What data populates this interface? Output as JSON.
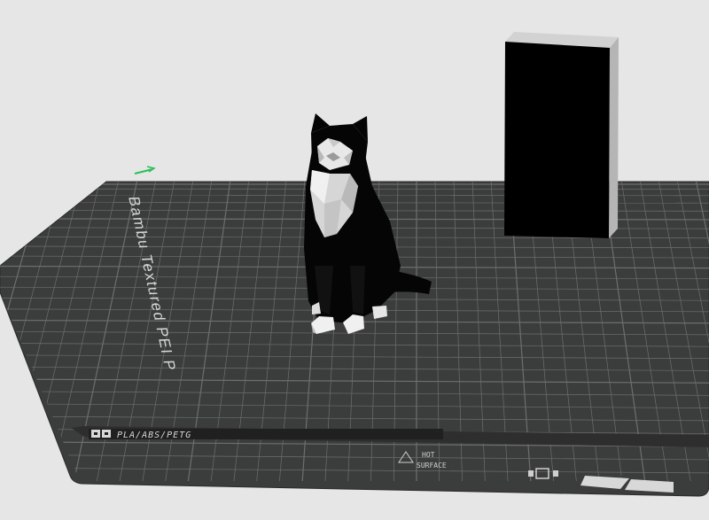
{
  "viewport": {
    "background": "#e6e6e6",
    "plate": {
      "name": "Bambu Textured PEI Plate",
      "surface_color": "#3b3d3c",
      "grid_color": "#6d6f6e",
      "edge_color": "#2a2b2a",
      "label_text": "Bambu Textured PEI P",
      "material_text": "PLA/ABS/PETG",
      "hot_line1": "HOT",
      "hot_line2": "SURFACE"
    },
    "axis_indicator": {
      "color": "#2bbf5a"
    },
    "objects": [
      {
        "name": "cat",
        "body_color": "#050505",
        "accent_color": "#cfcfcf"
      },
      {
        "name": "block",
        "front_color": "#000000",
        "side_color": "#b5b5b5",
        "top_color": "#d2d2d2"
      }
    ]
  }
}
